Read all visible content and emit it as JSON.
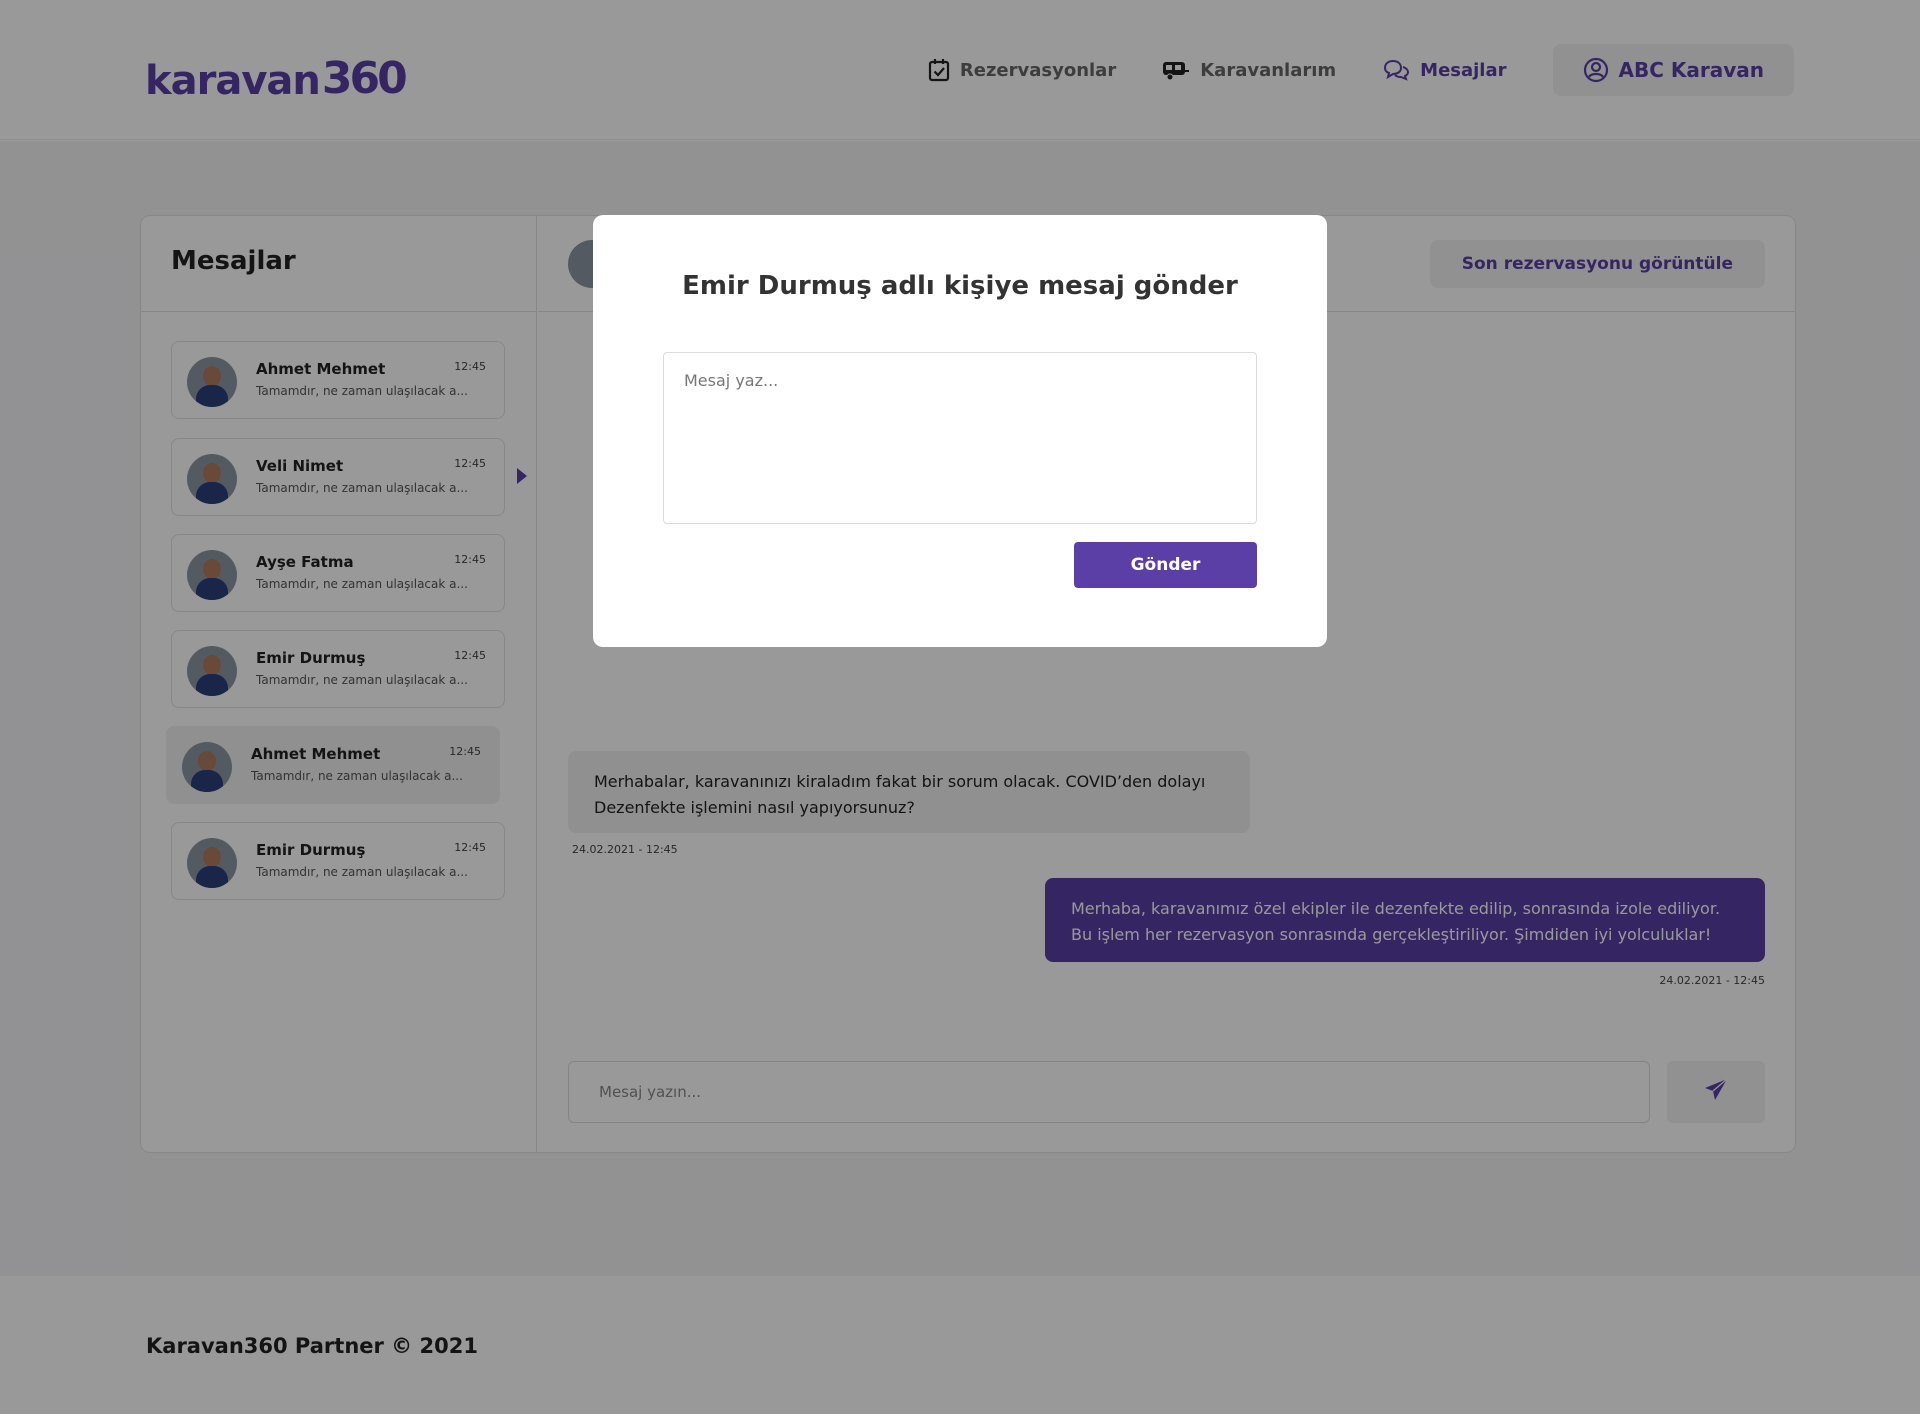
{
  "brand": {
    "logo_text": "karavan",
    "logo_num": "360",
    "accent": "#5b3fa6"
  },
  "nav": {
    "items": [
      {
        "label": "Rezervasyonlar",
        "icon": "calendar-check-icon"
      },
      {
        "label": "Karavanlarım",
        "icon": "caravan-icon"
      },
      {
        "label": "Mesajlar",
        "icon": "chat-bubbles-icon"
      }
    ],
    "account_label": "ABC Karavan",
    "account_icon": "user-circle-icon"
  },
  "messages_panel": {
    "title": "Mesajlar",
    "conversations": [
      {
        "name": "Ahmet Mehmet",
        "time": "12:45",
        "preview": "Tamamdır, ne zaman ulaşılacak a..."
      },
      {
        "name": "Veli Nimet",
        "time": "12:45",
        "preview": "Tamamdır, ne zaman ulaşılacak a..."
      },
      {
        "name": "Ayşe Fatma",
        "time": "12:45",
        "preview": "Tamamdır, ne zaman ulaşılacak a..."
      },
      {
        "name": "Emir Durmuş",
        "time": "12:45",
        "preview": "Tamamdır, ne zaman ulaşılacak a..."
      },
      {
        "name": "Ahmet Mehmet",
        "time": "12:45",
        "preview": "Tamamdır, ne zaman ulaşılacak a..."
      },
      {
        "name": "Emir Durmuş",
        "time": "12:45",
        "preview": "Tamamdır, ne zaman ulaşılacak a..."
      }
    ]
  },
  "chat": {
    "last_reservation_label": "Son rezervasyonu görüntüle",
    "incoming": {
      "line1": "Merhabalar, karavanınızı kiraladım fakat bir sorum olacak. COVID’den dolayı",
      "line2": "Dezenfekte işlemini nasıl yapıyorsunuz?",
      "time": "24.02.2021 - 12:45"
    },
    "outgoing": {
      "line1": "Merhaba, karavanımız özel ekipler ile dezenfekte edilip, sonrasında izole ediliyor.",
      "line2": "Bu işlem her rezervasyon sonrasında gerçekleştiriliyor. Şimdiden iyi yolculuklar!",
      "time": "24.02.2021 - 12:45"
    },
    "composer_placeholder": "Mesaj yazın...",
    "send_icon": "paper-plane-icon"
  },
  "modal": {
    "title": "Emir Durmuş adlı kişiye mesaj gönder",
    "textarea_placeholder": "Mesaj yaz...",
    "button_label": "Gönder"
  },
  "footer": {
    "text": "Karavan360 Partner © 2021"
  }
}
